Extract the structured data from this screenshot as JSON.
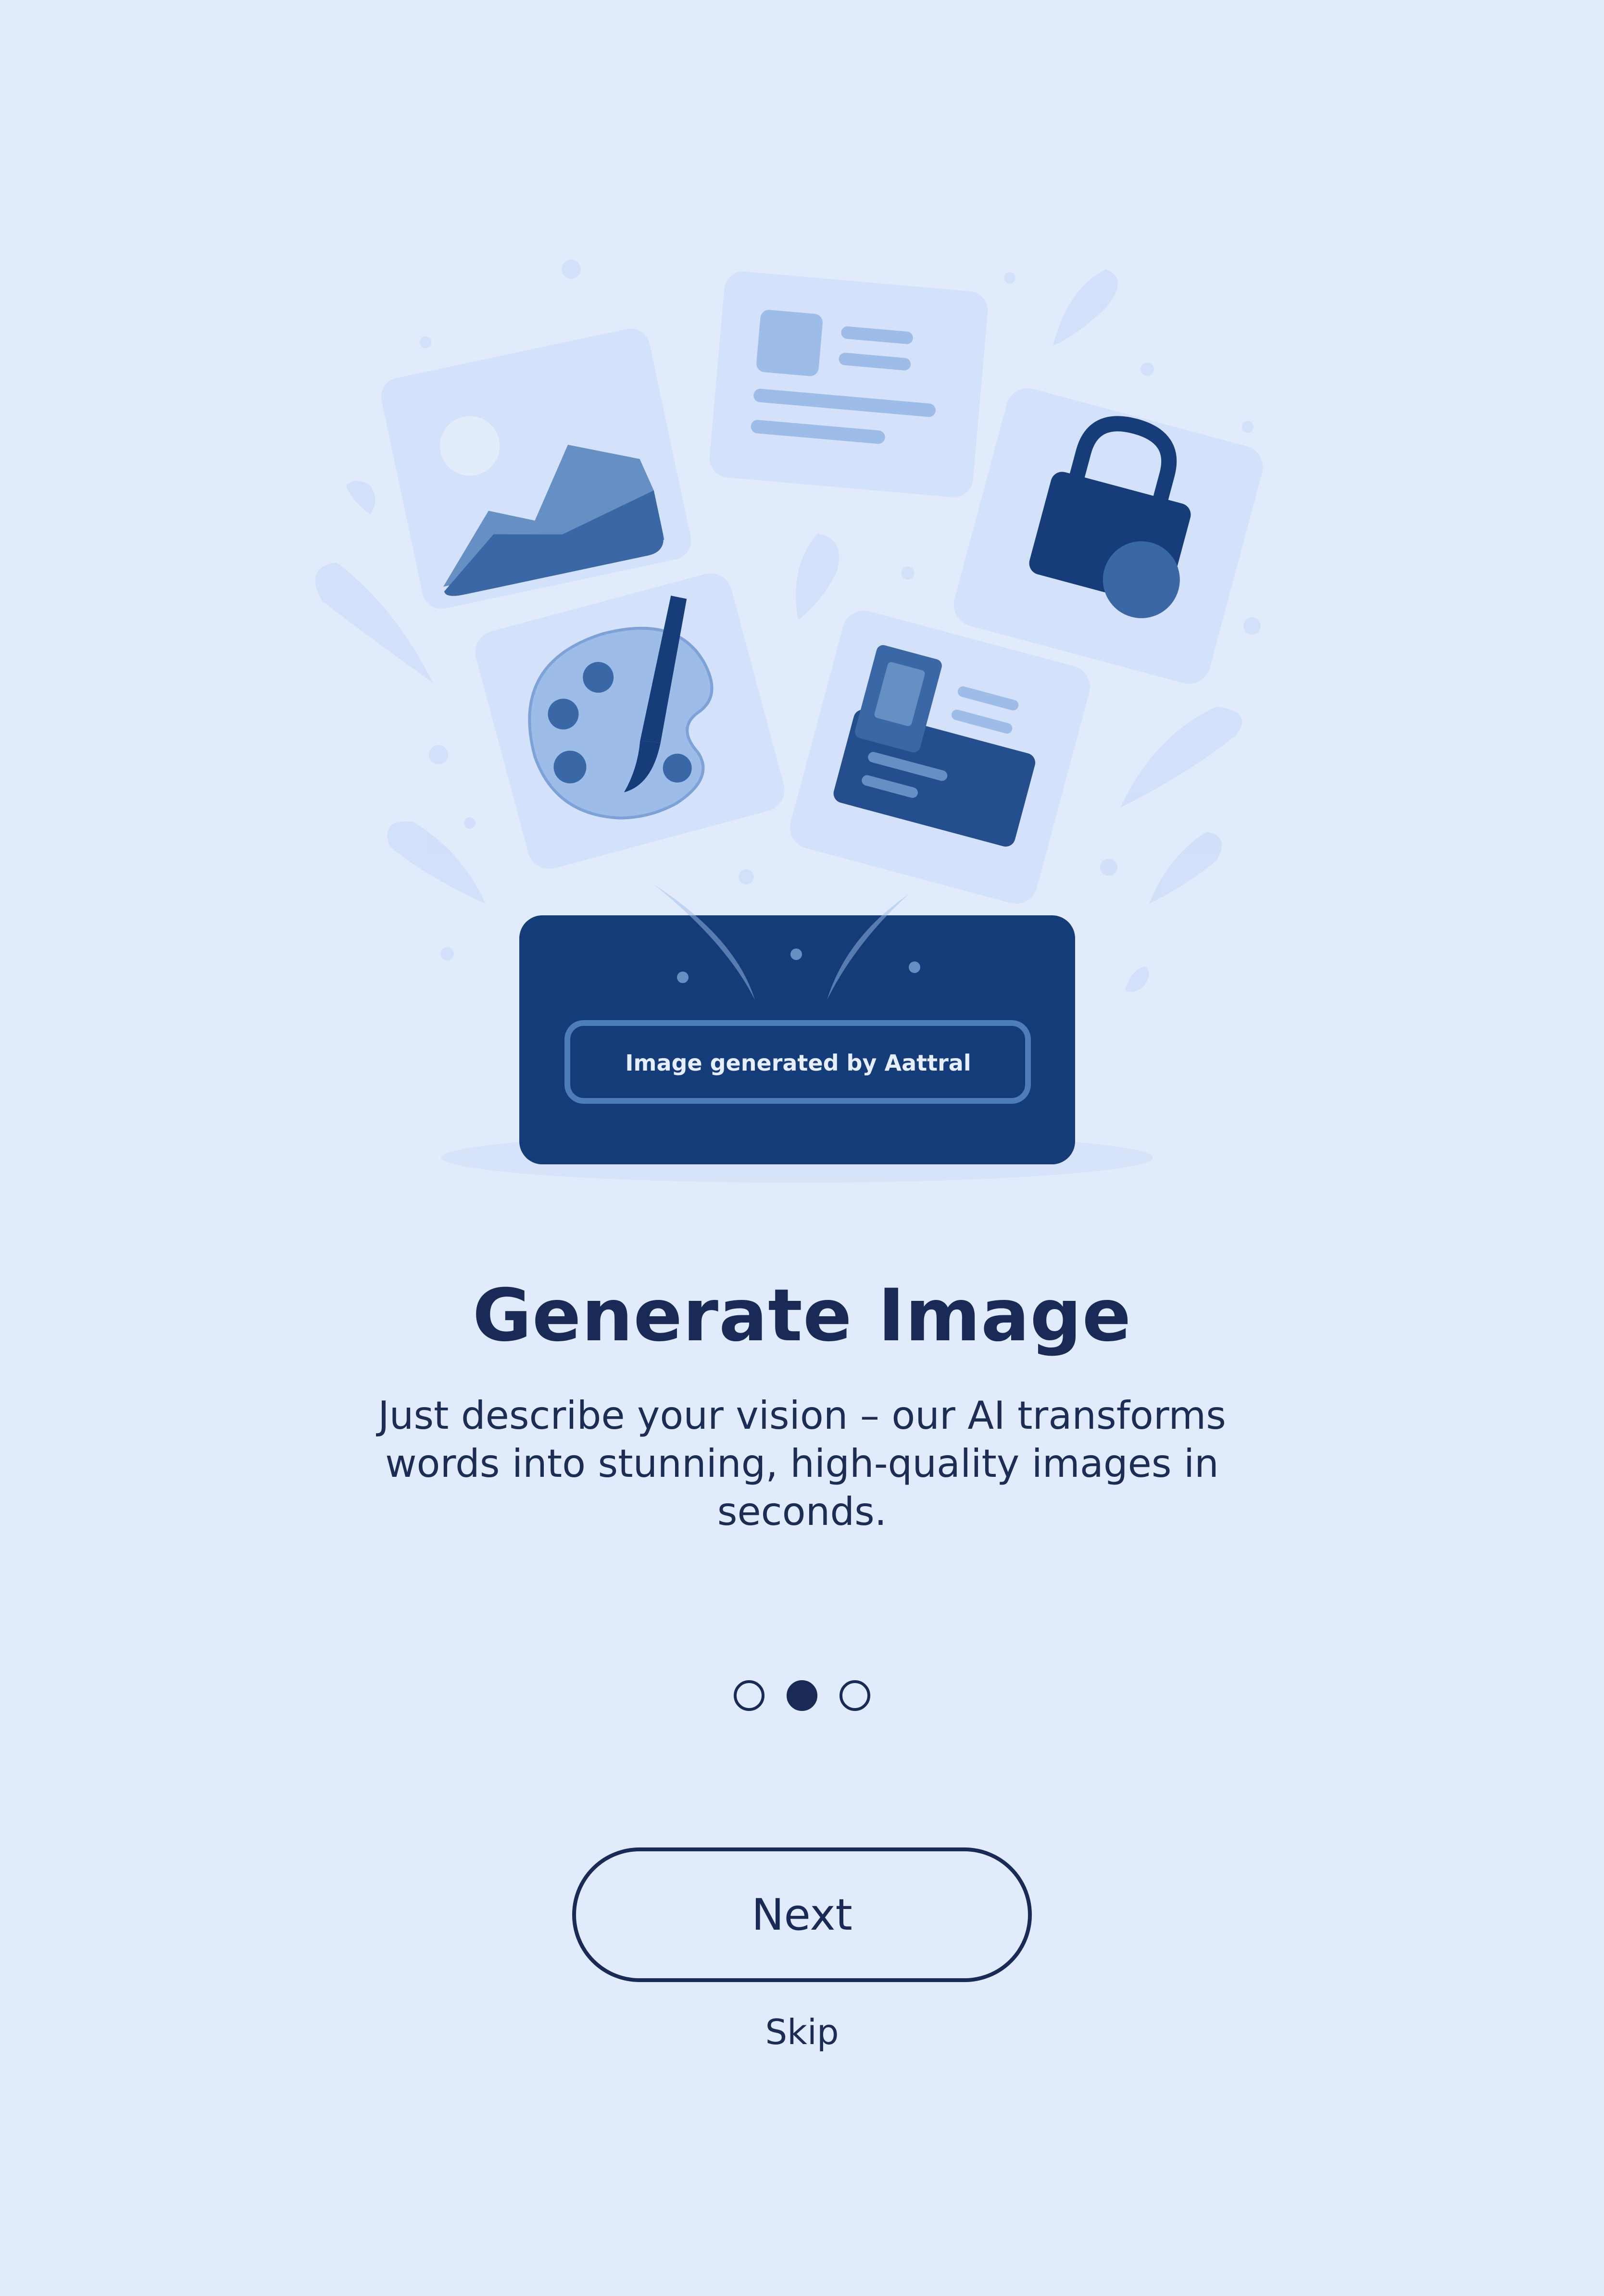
{
  "onboarding": {
    "badge_text": "Image generated by Aattral",
    "title": "Generate Image",
    "description": "Just describe your vision – our AI transforms words into stunning, high-quality images in seconds.",
    "pager": {
      "total": 3,
      "active_index": 1
    },
    "next_label": "Next",
    "skip_label": "Skip"
  },
  "colors": {
    "background": "#E1EBFC",
    "primary": "#1A2A57",
    "card": "#D3E2FA",
    "accent_dark": "#163D7A",
    "accent_mid": "#3A67A6",
    "accent_light": "#9DBCE8"
  },
  "icons": [
    "image-icon",
    "document-icon",
    "lock-icon",
    "palette-icon",
    "id-card-icon"
  ]
}
